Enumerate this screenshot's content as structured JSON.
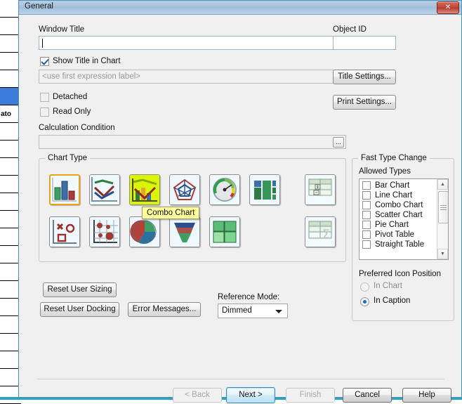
{
  "window": {
    "title": "General",
    "close_label": "✕"
  },
  "form": {
    "window_title_label": "Window Title",
    "window_title_value": "",
    "object_id_label": "Object ID",
    "object_id_value": "",
    "show_title_label": "Show Title in Chart",
    "show_title_checked": true,
    "title_expression_placeholder": "<use first expression label>",
    "detached_label": "Detached",
    "read_only_label": "Read Only",
    "calculation_condition_label": "Calculation Condition",
    "calculation_condition_value": "",
    "ellipsis_label": "...",
    "title_settings_label": "Title Settings...",
    "print_settings_label": "Print Settings..."
  },
  "chart_type": {
    "caption": "Chart Type",
    "selected": "Bar Chart",
    "hovered": "Combo Chart",
    "tooltip": "Combo Chart",
    "items": [
      {
        "name": "bar-chart",
        "label": "Bar Chart"
      },
      {
        "name": "line-chart",
        "label": "Line Chart"
      },
      {
        "name": "combo-chart",
        "label": "Combo Chart"
      },
      {
        "name": "radar-chart",
        "label": "Radar Chart"
      },
      {
        "name": "gauge-chart",
        "label": "Gauge Chart"
      },
      {
        "name": "block-chart",
        "label": "Block Chart"
      },
      {
        "name": "pivot-table",
        "label": "Pivot Table"
      },
      {
        "name": "scatter-chart",
        "label": "Scatter Chart"
      },
      {
        "name": "grid-chart",
        "label": "Grid Chart"
      },
      {
        "name": "pie-chart",
        "label": "Pie Chart"
      },
      {
        "name": "funnel-chart",
        "label": "Funnel Chart"
      },
      {
        "name": "mekko-chart",
        "label": "Mekko Chart"
      },
      {
        "name": "straight-table",
        "label": "Straight Table"
      }
    ]
  },
  "fast_type_change": {
    "caption": "Fast Type Change",
    "allowed_types_label": "Allowed Types",
    "allowed_types": [
      {
        "label": "Bar Chart",
        "checked": false
      },
      {
        "label": "Line Chart",
        "checked": false
      },
      {
        "label": "Combo Chart",
        "checked": false
      },
      {
        "label": "Scatter Chart",
        "checked": false
      },
      {
        "label": "Pie Chart",
        "checked": false
      },
      {
        "label": "Pivot Table",
        "checked": false
      },
      {
        "label": "Straight Table",
        "checked": false
      }
    ],
    "preferred_icon_position_label": "Preferred Icon Position",
    "in_chart_label": "In Chart",
    "in_caption_label": "In Caption",
    "selected_position": "In Caption"
  },
  "actions": {
    "reset_user_sizing": "Reset User Sizing",
    "reset_user_docking": "Reset User Docking",
    "error_messages": "Error Messages...",
    "reference_mode_label": "Reference Mode:",
    "reference_mode_value": "Dimmed"
  },
  "footer": {
    "back": "< Back",
    "next": "Next >",
    "finish": "Finish",
    "cancel": "Cancel",
    "help": "Help"
  },
  "background": {
    "row_text": "ato"
  },
  "colors": {
    "accent": "#3b7dd8",
    "selection_border": "#e8a317",
    "tooltip_bg": "#ffff9c",
    "titlebar": "#a8c3de",
    "close_red": "#c5493a"
  }
}
